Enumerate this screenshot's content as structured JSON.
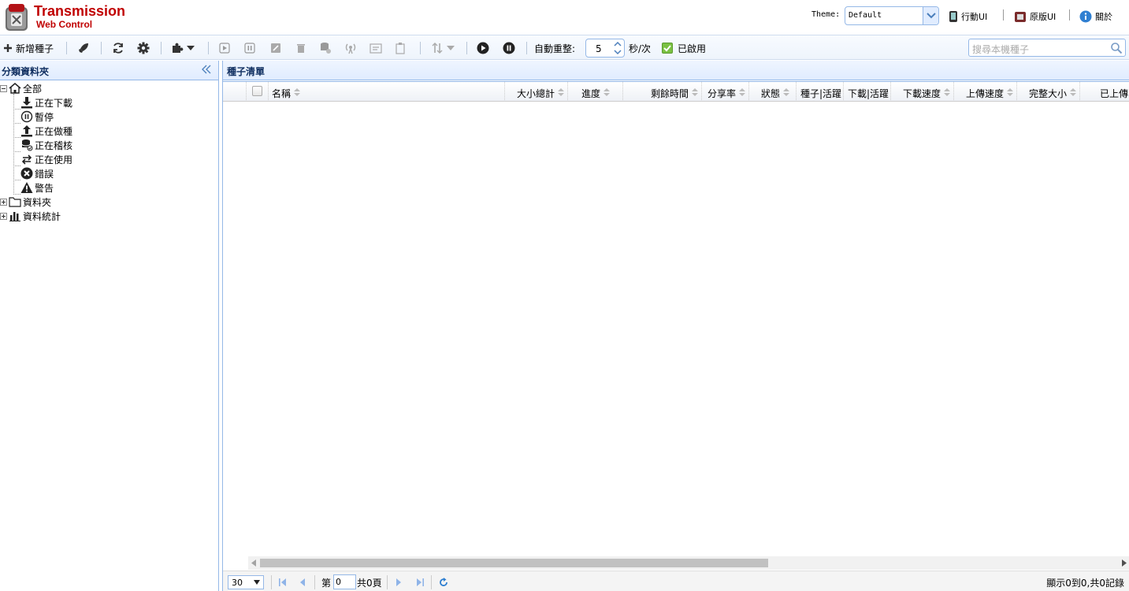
{
  "header": {
    "title": "Transmission",
    "subtitle": "Web Control",
    "theme_label": "Theme:",
    "theme_value": "Default",
    "mobile_ui": "行動UI",
    "original_ui": "原版UI",
    "about": "關於"
  },
  "toolbar": {
    "add_torrent": "新增種子",
    "auto_refresh_label": "自動重整:",
    "refresh_interval": "5",
    "interval_unit": "秒/次",
    "enabled_label": "已啟用",
    "search_placeholder": "搜尋本機種子"
  },
  "sidebar": {
    "title": "分類資料夾",
    "items": [
      {
        "label": "全部",
        "icon": "home-icon"
      },
      {
        "label": "正在下載",
        "icon": "download-icon"
      },
      {
        "label": "暫停",
        "icon": "pause-circle-icon"
      },
      {
        "label": "正在做種",
        "icon": "upload-icon"
      },
      {
        "label": "正在稽核",
        "icon": "check-database-icon"
      },
      {
        "label": "正在使用",
        "icon": "transfer-icon"
      },
      {
        "label": "錯誤",
        "icon": "error-icon"
      },
      {
        "label": "警告",
        "icon": "warning-icon"
      },
      {
        "label": "資料夾",
        "icon": "folder-icon"
      },
      {
        "label": "資料統計",
        "icon": "bar-chart-icon"
      }
    ]
  },
  "main": {
    "title": "種子清單",
    "columns": [
      {
        "label": "名稱"
      },
      {
        "label": "大小總計"
      },
      {
        "label": "進度"
      },
      {
        "label": "剩餘時間"
      },
      {
        "label": "分享率"
      },
      {
        "label": "狀態"
      },
      {
        "label": "種子|活躍"
      },
      {
        "label": "下載|活躍"
      },
      {
        "label": "下載速度"
      },
      {
        "label": "上傳速度"
      },
      {
        "label": "完整大小"
      },
      {
        "label": "已上傳"
      }
    ]
  },
  "pager": {
    "page_size": "30",
    "page_prefix": "第",
    "page_value": "0",
    "page_total": "共0頁",
    "info": "顯示0到0,共0記錄"
  },
  "colors": {
    "brand": "#c00000",
    "border": "#95b8e7",
    "panel_head": "#e0ecff",
    "enabled_check": "#7bc142"
  }
}
